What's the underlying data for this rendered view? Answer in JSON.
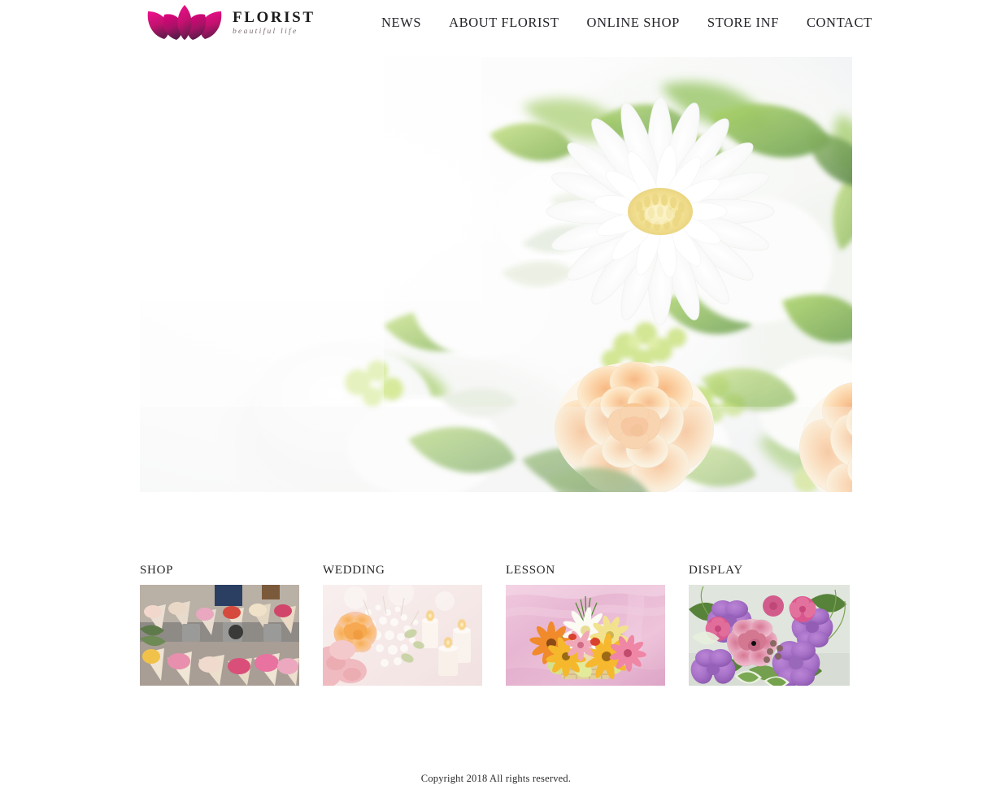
{
  "header": {
    "brand": {
      "logo_icon": "lotus-flower-icon",
      "name": "FLORIST",
      "tagline": "beautiful life",
      "logo_color_start": "#e6007e",
      "logo_color_end": "#7b1b56"
    },
    "nav": [
      {
        "label": "NEWS"
      },
      {
        "label": "ABOUT FLORIST"
      },
      {
        "label": "ONLINE SHOP"
      },
      {
        "label": "STORE INF"
      },
      {
        "label": "CONTACT"
      }
    ]
  },
  "hero": {
    "alt": "White gerbera daisy and peach garden roses bouquet with green foliage"
  },
  "categories": [
    {
      "label": "SHOP",
      "alt": "Flower market stall with wrapped bouquets in buckets"
    },
    {
      "label": "WEDDING",
      "alt": "Peach rose bridal bouquet with baby's breath and candles"
    },
    {
      "label": "LESSON",
      "alt": "Gerbera daisy basket arrangement on pink satin"
    },
    {
      "label": "DISPLAY",
      "alt": "Purple lisianthus and pink roses arrangement"
    }
  ],
  "footer": {
    "copyright": "Copyright 2018 All rights reserved."
  }
}
